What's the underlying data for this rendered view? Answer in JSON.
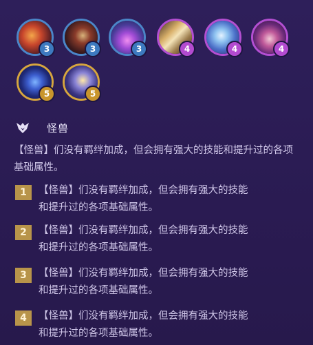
{
  "champions": [
    {
      "cost": "3",
      "tier": "t3"
    },
    {
      "cost": "3",
      "tier": "t3"
    },
    {
      "cost": "3",
      "tier": "t3"
    },
    {
      "cost": "4",
      "tier": "t4"
    },
    {
      "cost": "4",
      "tier": "t4"
    },
    {
      "cost": "4",
      "tier": "t4"
    },
    {
      "cost": "5",
      "tier": "t5"
    },
    {
      "cost": "5",
      "tier": "t5"
    }
  ],
  "trait": {
    "icon": "monster-trait-icon",
    "name": "怪兽",
    "description": "【怪兽】们没有羁绊加成，但会拥有强大的技能和提升过的各项基础属性。"
  },
  "tiers": [
    {
      "level": "1",
      "line1": "【怪兽】们没有羁绊加成，但会拥有强大的技能",
      "line2": "和提升过的各项基础属性。"
    },
    {
      "level": "2",
      "line1": "【怪兽】们没有羁绊加成，但会拥有强大的技能",
      "line2": "和提升过的各项基础属性。"
    },
    {
      "level": "3",
      "line1": "【怪兽】们没有羁绊加成，但会拥有强大的技能",
      "line2": "和提升过的各项基础属性。"
    },
    {
      "level": "4",
      "line1": "【怪兽】们没有羁绊加成，但会拥有强大的技能",
      "line2": "和提升过的各项基础属性。"
    }
  ],
  "colors": {
    "background": "#2b1d54",
    "tier3": "#4b86c8",
    "tier4": "#b44fd2",
    "tier5": "#d7a63e",
    "badge": "#b8944a"
  }
}
